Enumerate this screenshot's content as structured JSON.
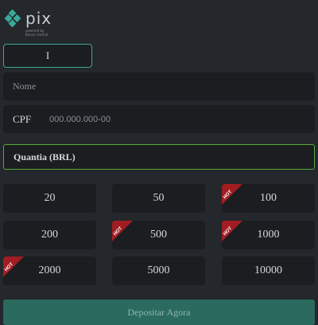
{
  "logo": {
    "word": "pix",
    "tagline": "powered by Banco Central",
    "icon": "pix-diamond-icon",
    "color": "#3aa89a"
  },
  "form": {
    "top_input_value": "I",
    "name_placeholder": "Nome",
    "cpf_label": "CPF",
    "cpf_placeholder": "000.000.000-00",
    "amount_label": "Quantia (BRL)"
  },
  "amounts": [
    {
      "value": "20",
      "hot": false
    },
    {
      "value": "50",
      "hot": false
    },
    {
      "value": "100",
      "hot": true
    },
    {
      "value": "200",
      "hot": false
    },
    {
      "value": "500",
      "hot": true
    },
    {
      "value": "1000",
      "hot": true
    },
    {
      "value": "2000",
      "hot": true
    },
    {
      "value": "5000",
      "hot": false
    },
    {
      "value": "10000",
      "hot": false
    }
  ],
  "hot_label": "HOT",
  "deposit_label": "Depositar Agora",
  "colors": {
    "background": "#24272b",
    "field": "#1b1d20",
    "accent": "#3aa89a",
    "amount_border": "#56a93c",
    "hot": "#a11d22",
    "deposit": "#2a6a5f"
  }
}
